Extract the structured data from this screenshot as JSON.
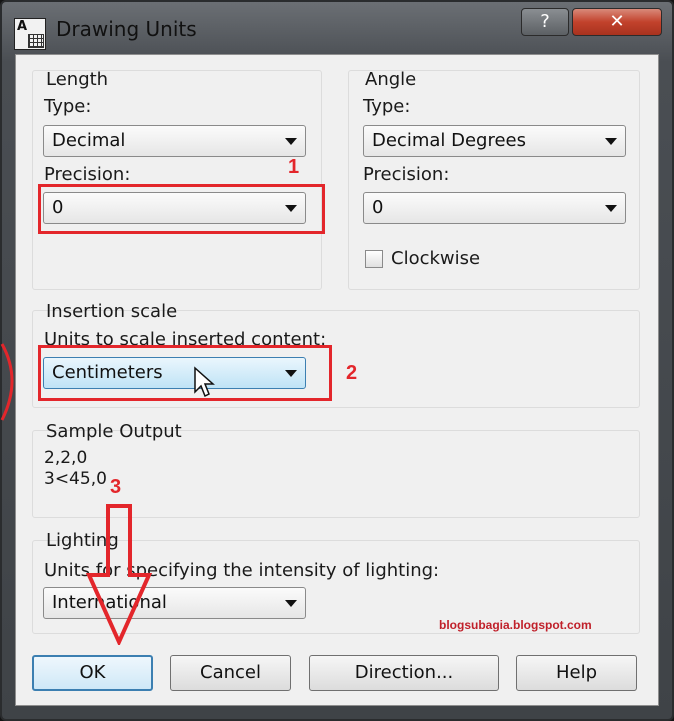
{
  "window": {
    "title": "Drawing Units",
    "help_glyph": "?",
    "close_glyph": "✕"
  },
  "length": {
    "group_label": "Length",
    "type_label": "Type:",
    "type_value": "Decimal",
    "precision_label": "Precision:",
    "precision_value": "0"
  },
  "angle": {
    "group_label": "Angle",
    "type_label": "Type:",
    "type_value": "Decimal Degrees",
    "precision_label": "Precision:",
    "precision_value": "0",
    "clockwise_label": "Clockwise",
    "clockwise_checked": false
  },
  "insertion": {
    "group_label": "Insertion scale",
    "units_label": "Units to scale inserted content:",
    "units_value": "Centimeters"
  },
  "sample": {
    "group_label": "Sample Output",
    "line1": "2,2,0",
    "line2": "3<45,0"
  },
  "lighting": {
    "group_label": "Lighting",
    "units_label": "Units for specifying the intensity of lighting:",
    "units_value": "International"
  },
  "buttons": {
    "ok": "OK",
    "cancel": "Cancel",
    "direction": "Direction...",
    "help": "Help"
  },
  "annotations": {
    "n1": "1",
    "n2": "2",
    "n3": "3",
    "watermark": "blogsubagia.blogspot.com",
    "color": "#e3262b"
  }
}
